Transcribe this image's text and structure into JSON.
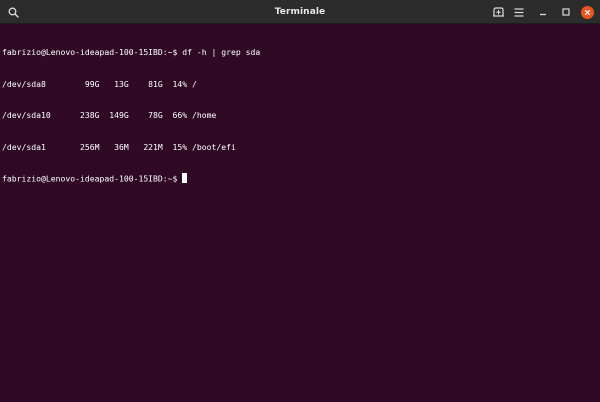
{
  "window": {
    "title": "Terminale",
    "icons": {
      "search": "search-icon",
      "new_tab": "new-tab-icon",
      "menu": "hamburger-menu-icon",
      "minimize": "minimize-icon",
      "maximize": "maximize-icon",
      "close": "close-icon"
    },
    "colors": {
      "titlebar": "#2c2c2c",
      "terminal_bg": "#300a24",
      "close_button": "#e95420",
      "text": "#ffffff"
    }
  },
  "terminal": {
    "lines": [
      "fabrizio@Lenovo-ideapad-100-15IBD:~$ df -h | grep sda",
      "/dev/sda8        99G   13G    81G  14% /",
      "/dev/sda10      238G  149G    78G  66% /home",
      "/dev/sda1       256M   36M   221M  15% /boot/efi"
    ],
    "prompt": "fabrizio@Lenovo-ideapad-100-15IBD:~$ "
  }
}
